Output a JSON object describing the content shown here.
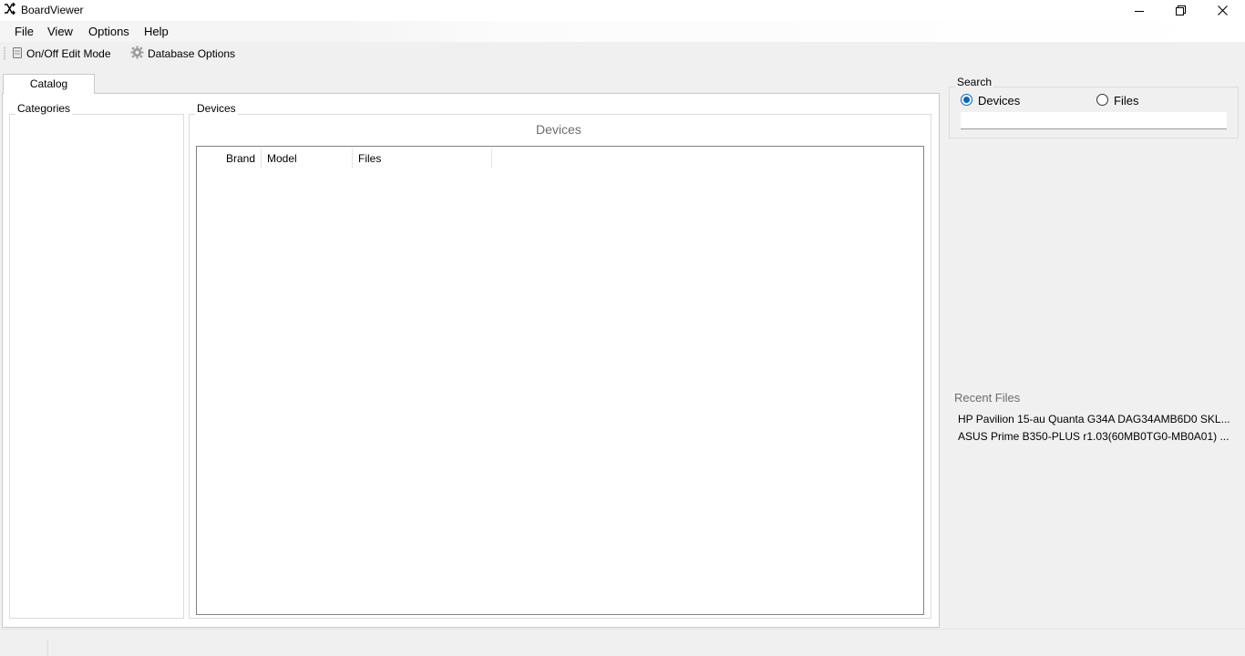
{
  "window": {
    "title": "BoardViewer",
    "app_icon": "shuffle-icon",
    "controls": [
      "minimize-icon",
      "restore-icon",
      "close-icon"
    ]
  },
  "menu": {
    "items": [
      {
        "label": "File"
      },
      {
        "label": "View"
      },
      {
        "label": "Options"
      },
      {
        "label": "Help"
      }
    ]
  },
  "toolbar": {
    "edit_mode_label": "On/Off Edit Mode",
    "edit_mode_icon": "database-icon",
    "db_options_label": "Database Options",
    "db_options_icon": "gear-icon"
  },
  "tabs": [
    {
      "label": "Catalog",
      "selected": true
    }
  ],
  "catalog": {
    "categories_title": "Categories",
    "devices_group_title": "Devices",
    "devices_caption": "Devices",
    "columns": [
      {
        "label": "Brand"
      },
      {
        "label": "Model"
      },
      {
        "label": "Files"
      }
    ],
    "rows": []
  },
  "search": {
    "title": "Search",
    "options": [
      {
        "label": "Devices",
        "checked": true
      },
      {
        "label": "Files",
        "checked": false
      }
    ],
    "value": ""
  },
  "recent": {
    "title": "Recent Files",
    "items": [
      {
        "label": "HP Pavilion 15-au Quanta G34A DAG34AMB6D0 SKL..."
      },
      {
        "label": "ASUS Prime B350-PLUS r1.03(60MB0TG0-MB0A01) ..."
      }
    ]
  },
  "colors": {
    "accent": "#0067c0",
    "window_bg": "#f0f0f0",
    "panel_bg": "#ffffff",
    "muted_text": "#6d6d6d"
  }
}
